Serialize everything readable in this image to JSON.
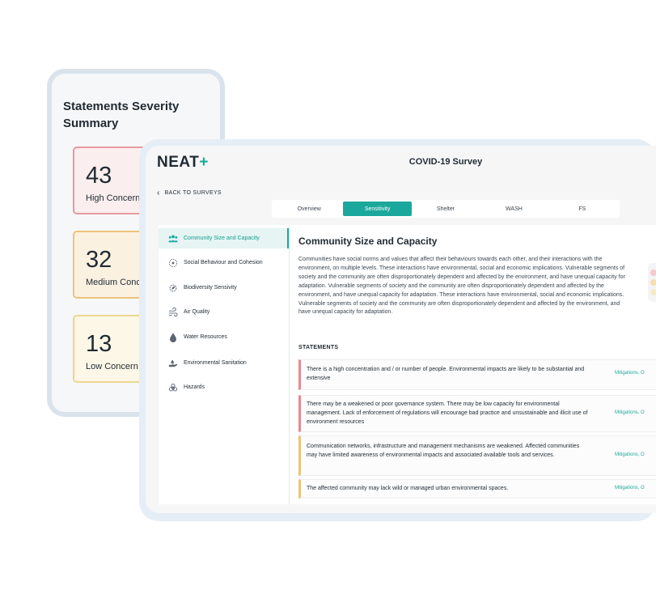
{
  "summary": {
    "title": "Statements Severity Summary",
    "items": [
      {
        "count": "43",
        "label": "High Concern",
        "color": "#e69ba0"
      },
      {
        "count": "32",
        "label": "Medium Concern",
        "color": "#ecc37b"
      },
      {
        "count": "13",
        "label": "Low Concern",
        "color": "#ead892"
      }
    ]
  },
  "app": {
    "logo_text": "NEAT",
    "logo_plus": "+",
    "survey_title": "COVID-19 Survey",
    "back_label": "BACK TO SURVEYS",
    "accent_color": "#1ba89c",
    "tabs": [
      {
        "label": "Overview",
        "active": false
      },
      {
        "label": "Sensitivity",
        "active": true
      },
      {
        "label": "Shelter",
        "active": false
      },
      {
        "label": "WASH",
        "active": false
      },
      {
        "label": "FS",
        "active": false
      }
    ],
    "sidebar": [
      {
        "label": "Community Size and Capacity",
        "icon": "people-icon",
        "active": true
      },
      {
        "label": "Social Behaviour and Cohesion",
        "icon": "social-network-icon",
        "active": false
      },
      {
        "label": "Biodiversity Sensivity",
        "icon": "leaf-gear-icon",
        "active": false
      },
      {
        "label": "Air Quality",
        "icon": "wind-icon",
        "active": false
      },
      {
        "label": "Water Resources",
        "icon": "water-drop-icon",
        "active": false
      },
      {
        "label": "Environmental Sanitation",
        "icon": "hand-care-icon",
        "active": false
      },
      {
        "label": "Hazards",
        "icon": "biohazard-icon",
        "active": false
      }
    ],
    "main": {
      "title": "Community Size and Capacity",
      "description": "Communities have social norms and values that affect their behaviours towards each other, and their interactions with the environment, on multiple levels. These interactions have environmental, social and economic implications. Vulnerable segments of society and the community are often disproportionately dependent and affected by the environment, and have unequal capacity for adaptation. Vulnerable segments of society and the community are often disproportionately dependent and affected by the environment, and have unequal capacity for adaptation. These interactions have environmental, social and economic implications. Vulnerable segments of society and the community are often disproportionately dependent and affected by the environment, and have unequal capacity for adaptation.",
      "statements_label": "STATEMENTS",
      "statements": [
        {
          "text": "There is a high concentration and / or number of people. Environmental impacts are likely to be substantial and extensive",
          "link": "Mitigations, O",
          "severity_color": "#e6898f"
        },
        {
          "text": "There may be a weakened or poor governance system. There may be low capacity for environmental management. Lack of enforcement of regulations will encourage bad practice and unsustainable and illicit use of environment resources",
          "link": "Mitigations, O",
          "severity_color": "#e6898f"
        },
        {
          "text": "Communication networks, infrastructure and management mechanisms are weakened. Affected communities may have limited awareness of environmental impacts and associated available tools and services.",
          "link": "Mitigations, O",
          "severity_color": "#ecc37b"
        },
        {
          "text": "The affected community may lack wild or managed urban environmental spaces.",
          "link": "Mitigations, O",
          "severity_color": "#ecc37b"
        }
      ]
    }
  }
}
